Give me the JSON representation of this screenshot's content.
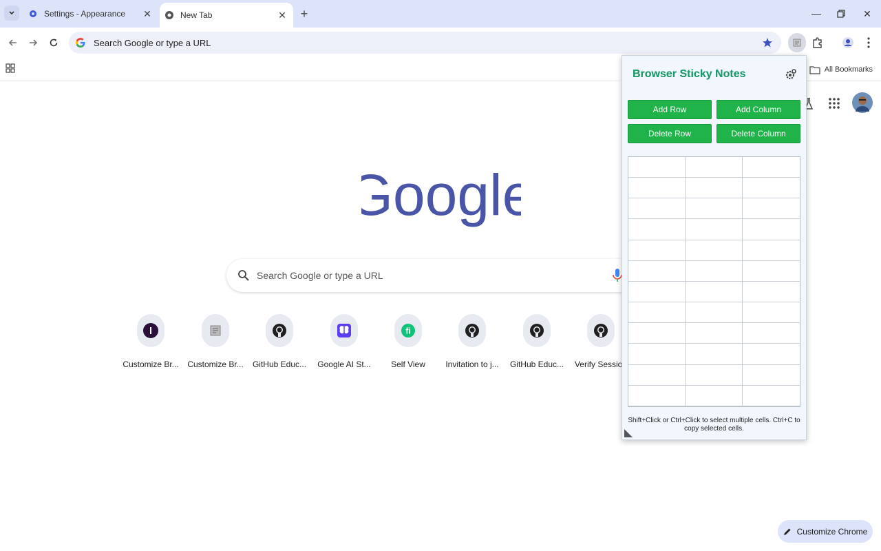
{
  "tabs": [
    {
      "label": "Settings - Appearance",
      "icon": "gear-icon"
    },
    {
      "label": "New Tab",
      "icon": "chrome-icon"
    }
  ],
  "omnibox": {
    "text": "Search Google or type a URL"
  },
  "bookmarks": {
    "all_label": "All Bookmarks"
  },
  "logo": {
    "text": "Google"
  },
  "ntp_search": {
    "placeholder": "Search Google or type a URL"
  },
  "shortcuts": [
    {
      "label": "Customize Br...",
      "icon": "I"
    },
    {
      "label": "Customize Br...",
      "icon": "notes"
    },
    {
      "label": "GitHub Educ...",
      "icon": "github"
    },
    {
      "label": "Google AI St...",
      "icon": "butterfly"
    },
    {
      "label": "Self View",
      "icon": "fi"
    },
    {
      "label": "Invitation to j...",
      "icon": "github"
    },
    {
      "label": "GitHub Educ...",
      "icon": "github"
    },
    {
      "label": "Verify Session",
      "icon": "github"
    }
  ],
  "customize": {
    "label": "Customize Chrome"
  },
  "sticky": {
    "title": "Browser Sticky Notes",
    "buttons": {
      "add_row": "Add Row",
      "add_column": "Add Column",
      "delete_row": "Delete Row",
      "delete_column": "Delete Column"
    },
    "rows": 12,
    "columns": 3,
    "hint": "Shift+Click or Ctrl+Click to select multiple cells. Ctrl+C to copy selected cells."
  },
  "colors": {
    "accent_green": "#1fb34a",
    "chrome_frame": "#dde3f8",
    "google_logo": "#4a55a8"
  }
}
